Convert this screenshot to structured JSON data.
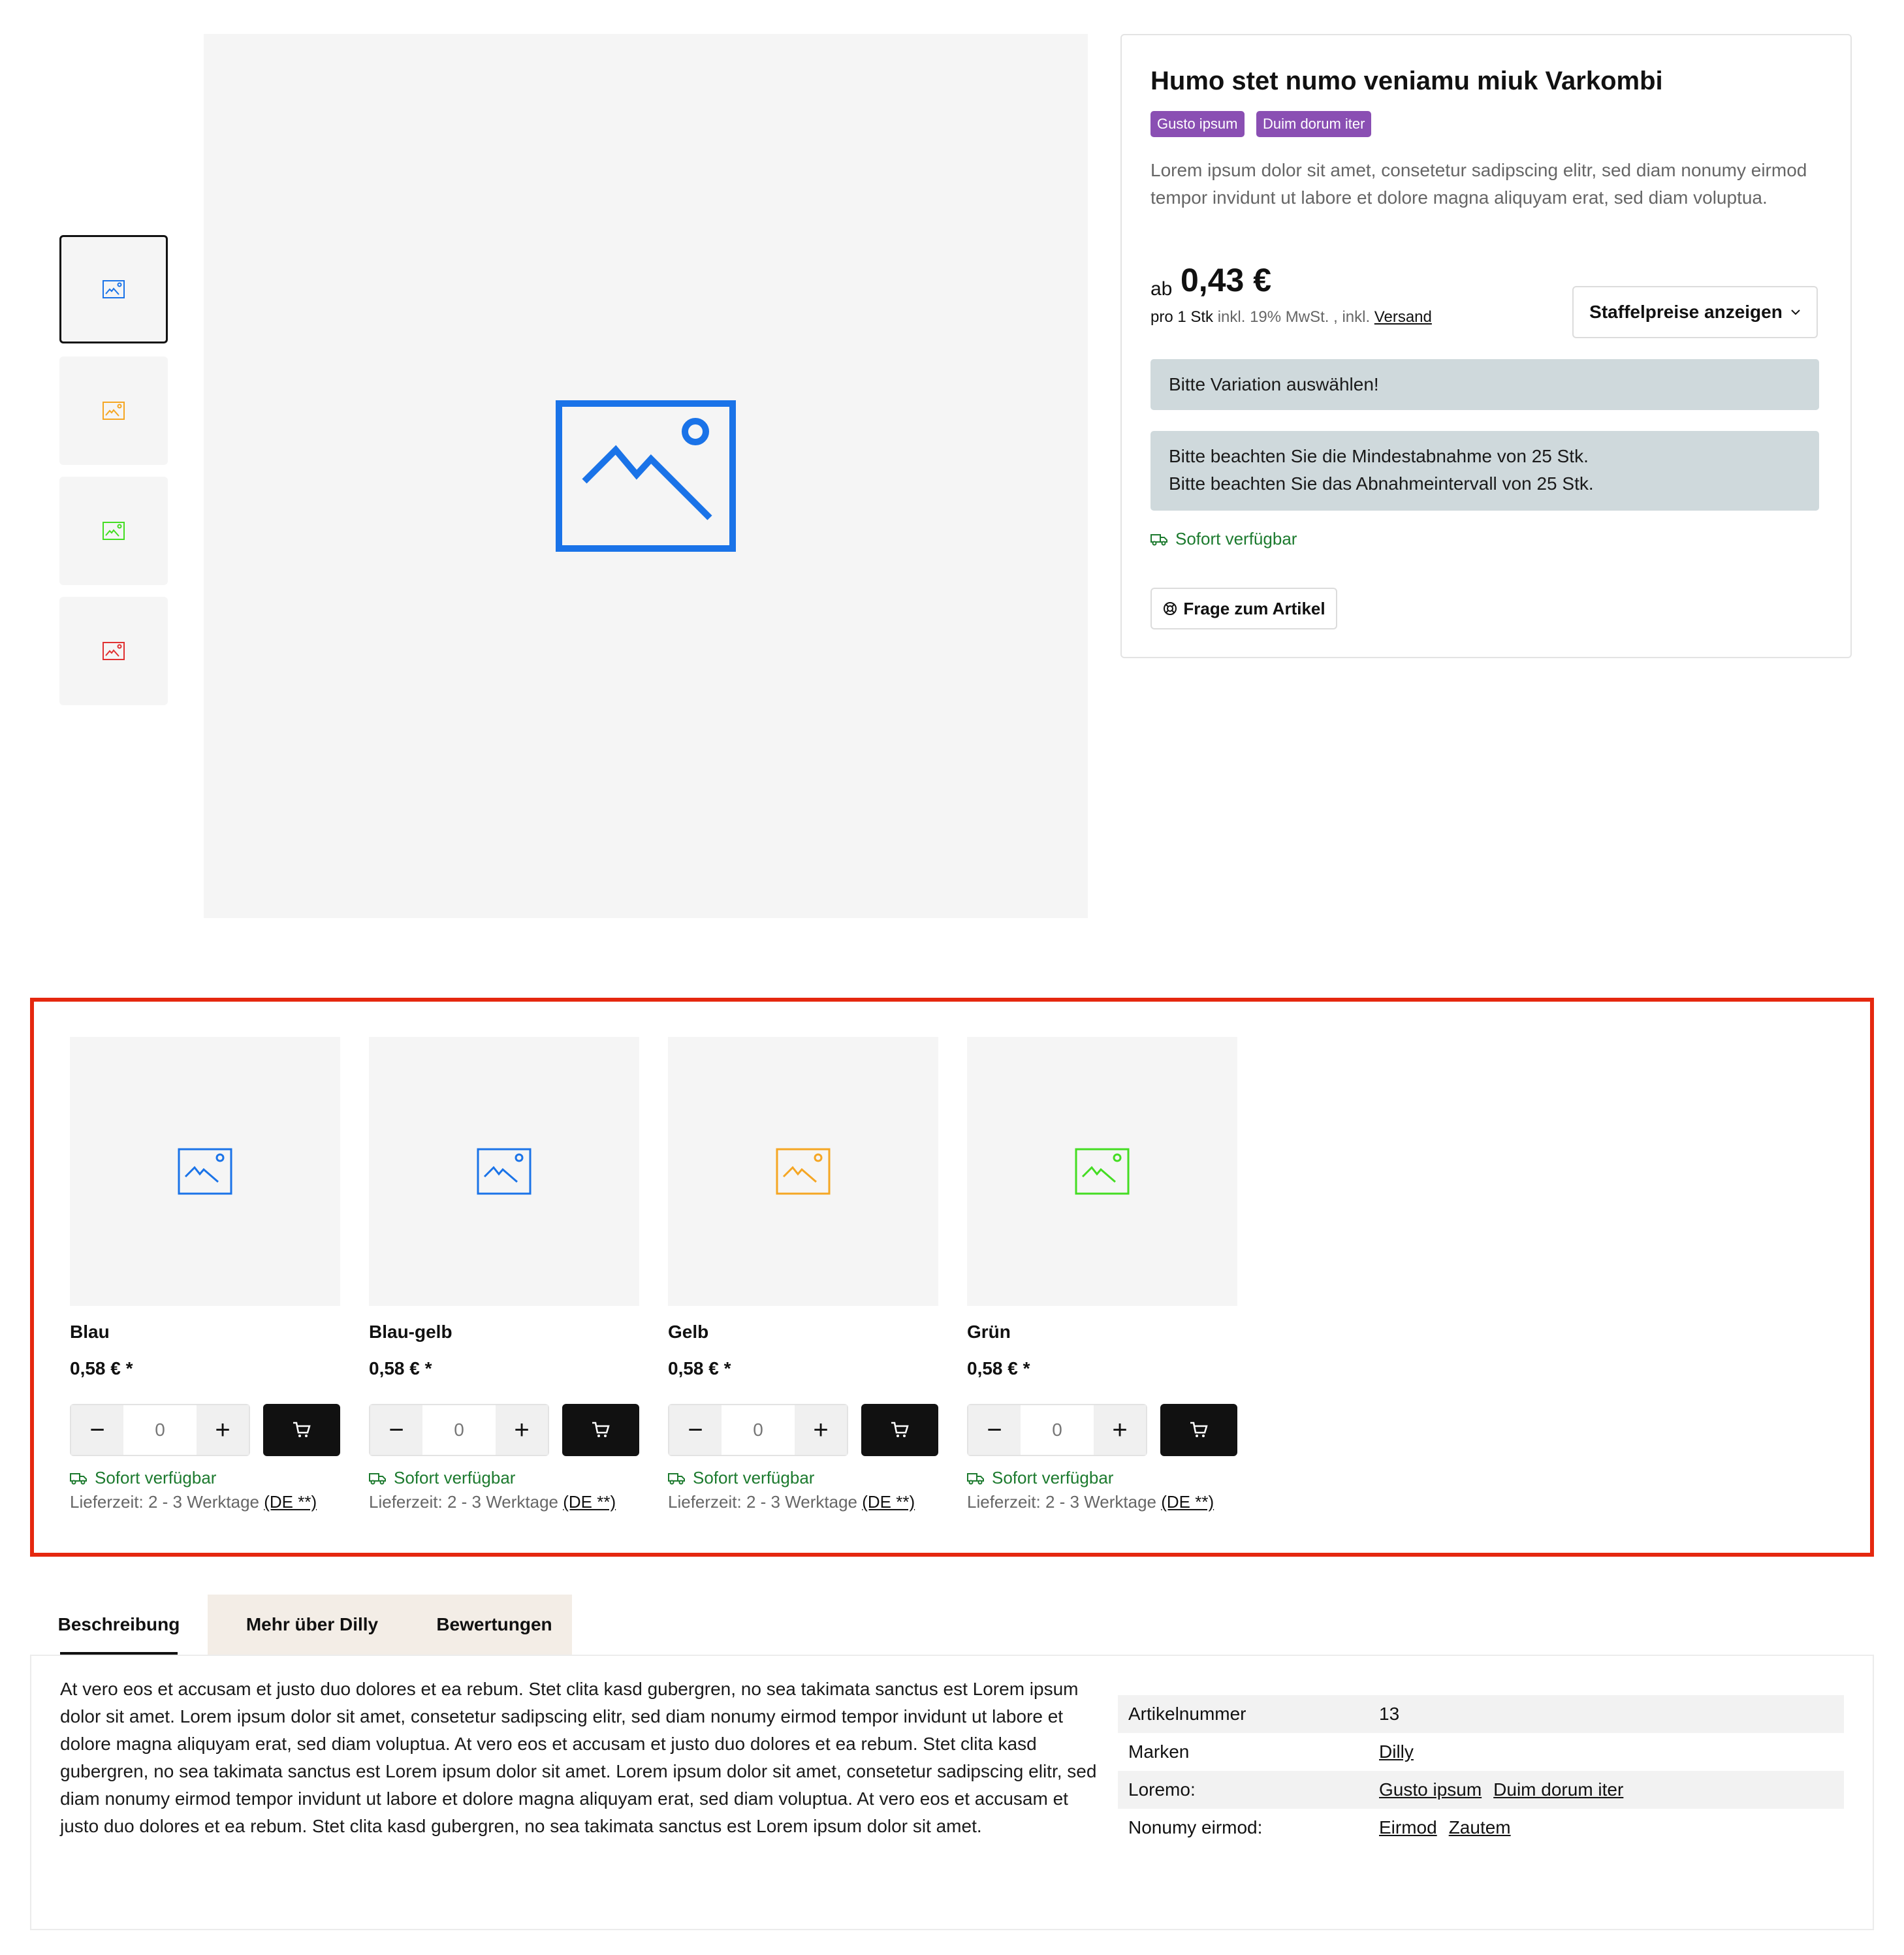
{
  "gallery": {
    "thumbnails": [
      {
        "color": "#1a73e8",
        "icon": "image-icon"
      },
      {
        "color": "#f5a623",
        "icon": "image-icon"
      },
      {
        "color": "#44dd22",
        "icon": "image-icon"
      },
      {
        "color": "#e03131",
        "icon": "image-icon"
      }
    ],
    "main_image_color": "#1a73e8"
  },
  "product": {
    "title": "Humo stet numo veniamu miuk Varkombi",
    "badges": [
      "Gusto ipsum",
      "Duim dorum iter"
    ],
    "description": "Lorem ipsum dolor sit amet, consetetur sadipscing elitr, sed diam nonumy eirmod tempor invidunt ut labore et dolore magna aliquyam erat, sed diam voluptua.",
    "price_prefix": "ab",
    "price": "0,43 €",
    "unit_label": "pro 1 Stk",
    "tax_text": " inkl. 19% MwSt. , inkl. ",
    "shipping_link": "Versand",
    "staffel_button": "Staffelpreise anzeigen",
    "alert_variation": "Bitte Variation auswählen!",
    "alert_min_order": "Bitte beachten Sie die Mindestabnahme von 25 Stk.",
    "alert_interval": "Bitte beachten Sie das Abnahmeintervall von 25 Stk.",
    "availability": "Sofort verfügbar",
    "question_button": "Frage zum Artikel"
  },
  "variations": [
    {
      "name": "Blau",
      "price": "0,58 € *",
      "qty": "0",
      "color": "#1a73e8",
      "availability": "Sofort verfügbar",
      "delivery": "Lieferzeit: 2 - 3 Werktage ",
      "delivery_link": "(DE **)"
    },
    {
      "name": "Blau-gelb",
      "price": "0,58 € *",
      "qty": "0",
      "color": "#1a73e8",
      "availability": "Sofort verfügbar",
      "delivery": "Lieferzeit: 2 - 3 Werktage ",
      "delivery_link": "(DE **)"
    },
    {
      "name": "Gelb",
      "price": "0,58 € *",
      "qty": "0",
      "color": "#f5a623",
      "availability": "Sofort verfügbar",
      "delivery": "Lieferzeit: 2 - 3 Werktage ",
      "delivery_link": "(DE **)"
    },
    {
      "name": "Grün",
      "price": "0,58 € *",
      "qty": "0",
      "color": "#44dd22",
      "availability": "Sofort verfügbar",
      "delivery": "Lieferzeit: 2 - 3 Werktage ",
      "delivery_link": "(DE **)"
    }
  ],
  "tabs": [
    "Beschreibung",
    "Mehr über Dilly",
    "Bewertungen"
  ],
  "long_description": "At vero eos et accusam et justo duo dolores et ea rebum. Stet clita kasd gubergren, no sea takimata sanctus est Lorem ipsum dolor sit amet. Lorem ipsum dolor sit amet, consetetur sadipscing elitr, sed diam nonumy eirmod tempor invidunt ut labore et dolore magna aliquyam erat, sed diam voluptua. At vero eos et accusam et justo duo dolores et ea rebum. Stet clita kasd gubergren, no sea takimata sanctus est Lorem ipsum dolor sit amet. Lorem ipsum dolor sit amet, consetetur sadipscing elitr, sed diam nonumy eirmod tempor invidunt ut labore et dolore magna aliquyam erat, sed diam voluptua. At vero eos et accusam et justo duo dolores et ea rebum. Stet clita kasd gubergren, no sea takimata sanctus est Lorem ipsum dolor sit amet.",
  "properties": [
    {
      "key": "Artikelnummer",
      "values": [
        "13"
      ],
      "links": false
    },
    {
      "key": "Marken",
      "values": [
        "Dilly"
      ],
      "links": true
    },
    {
      "key": "Loremo:",
      "values": [
        "Gusto ipsum",
        "Duim dorum iter"
      ],
      "links": true
    },
    {
      "key": "Nonumy eirmod:",
      "values": [
        "Eirmod",
        "Zautem"
      ],
      "links": true
    }
  ],
  "colors": {
    "accent_badge": "#8a4fb3",
    "availability_green": "#1c7a2e",
    "alert_bg": "#cfd9dc",
    "highlight_frame": "#e5280f"
  }
}
